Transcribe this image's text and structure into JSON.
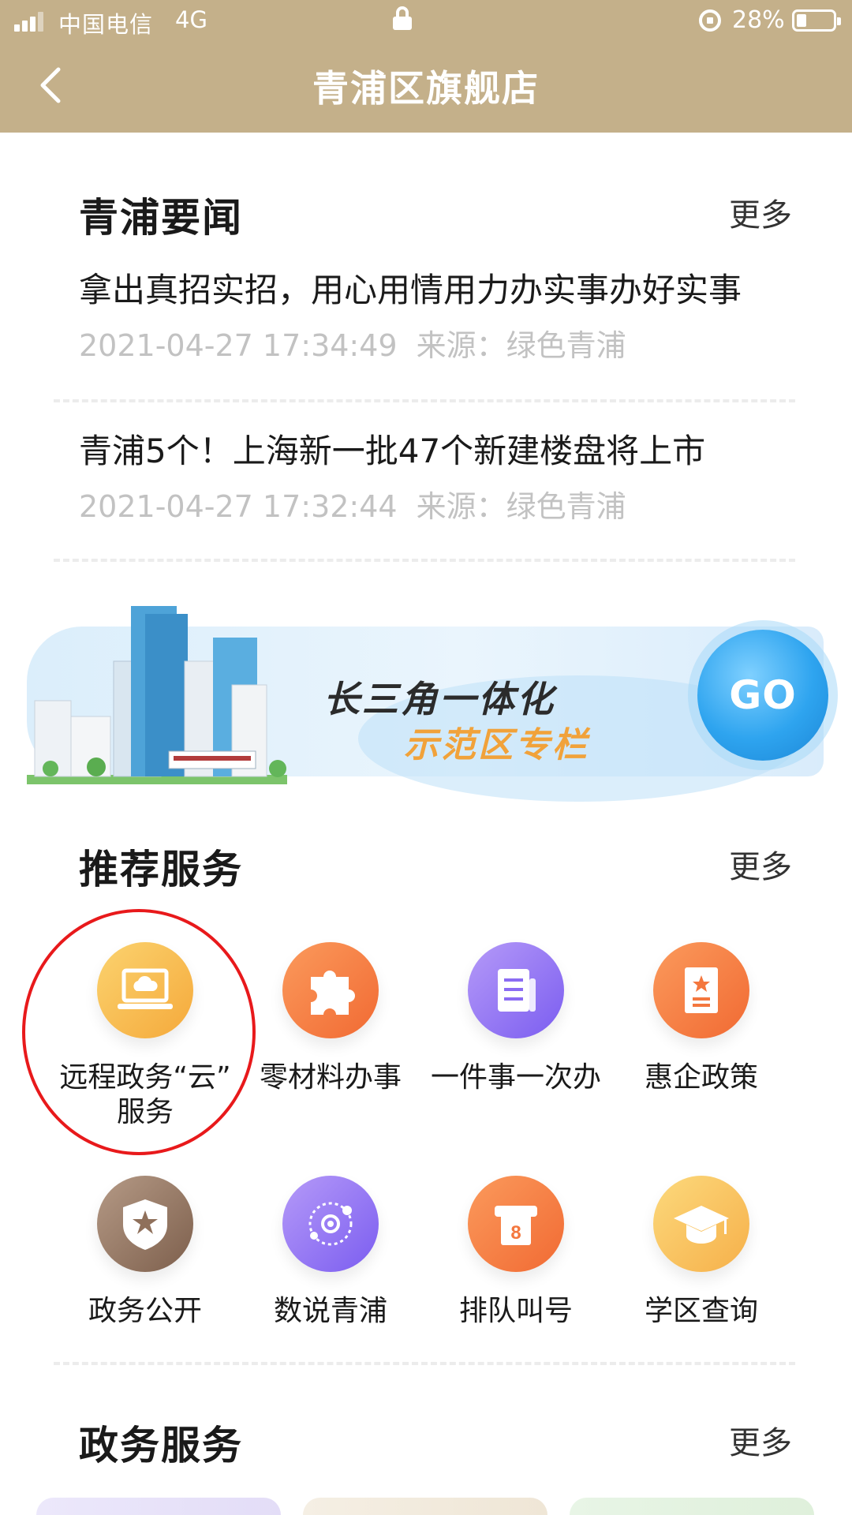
{
  "status_bar": {
    "carrier": "中国电信",
    "network": "4G",
    "battery_percent": "28%",
    "battery_level": 0.28
  },
  "header": {
    "title": "青浦区旗舰店"
  },
  "news": {
    "title": "青浦要闻",
    "more": "更多",
    "items": [
      {
        "title": "拿出真招实招，用心用情用力办实事办好实事",
        "datetime": "2021-04-27 17:34:49",
        "source": "来源：绿色青浦"
      },
      {
        "title": "青浦5个！上海新一批47个新建楼盘将上市",
        "datetime": "2021-04-27 17:32:44",
        "source": "来源：绿色青浦"
      }
    ]
  },
  "banner": {
    "title": "长三角一体化",
    "subtitle": "示范区专栏",
    "go_label": "GO"
  },
  "recommended": {
    "title": "推荐服务",
    "more": "更多",
    "items": [
      {
        "label_line1": "远程政务“云”",
        "label_line2": "服务",
        "icon": "cloud-laptop-icon",
        "color": "#f7b447"
      },
      {
        "label_line1": "零材料办事",
        "icon": "puzzle-icon",
        "color": "#f4773e"
      },
      {
        "label_line1": "一件事一次办",
        "icon": "document-icon",
        "color": "#8b6cf3"
      },
      {
        "label_line1": "惠企政策",
        "icon": "policy-book-icon",
        "color": "#f4773e"
      },
      {
        "label_line1": "政务公开",
        "icon": "shield-star-icon",
        "color": "#8f705b"
      },
      {
        "label_line1": "数说青浦",
        "icon": "orbit-icon",
        "color": "#8b6cf3"
      },
      {
        "label_line1": "排队叫号",
        "icon": "queue-ticket-icon",
        "color": "#f4773e"
      },
      {
        "label_line1": "学区查询",
        "icon": "graduation-cap-icon",
        "color": "#f8b84f"
      }
    ]
  },
  "government": {
    "title": "政务服务",
    "more": "更多"
  }
}
